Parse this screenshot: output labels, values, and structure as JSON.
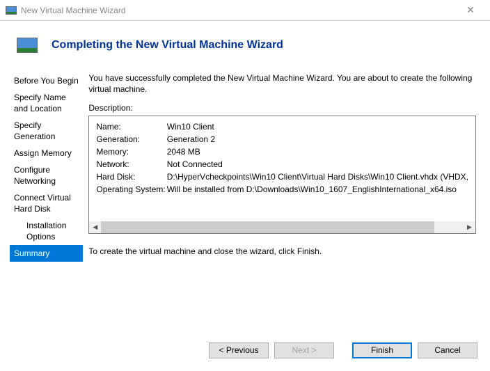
{
  "window": {
    "title": "New Virtual Machine Wizard"
  },
  "header": {
    "title": "Completing the New Virtual Machine Wizard"
  },
  "sidebar": {
    "items": [
      {
        "label": "Before You Begin",
        "indent": false
      },
      {
        "label": "Specify Name and Location",
        "indent": false
      },
      {
        "label": "Specify Generation",
        "indent": false
      },
      {
        "label": "Assign Memory",
        "indent": false
      },
      {
        "label": "Configure Networking",
        "indent": false
      },
      {
        "label": "Connect Virtual Hard Disk",
        "indent": false
      },
      {
        "label": "Installation Options",
        "indent": true
      },
      {
        "label": "Summary",
        "indent": false,
        "selected": true
      }
    ]
  },
  "main": {
    "intro": "You have successfully completed the New Virtual Machine Wizard. You are about to create the following virtual machine.",
    "description_label": "Description:",
    "summary": {
      "name_label": "Name:",
      "name_value": "Win10 Client",
      "generation_label": "Generation:",
      "generation_value": "Generation 2",
      "memory_label": "Memory:",
      "memory_value": "2048 MB",
      "network_label": "Network:",
      "network_value": "Not Connected",
      "harddisk_label": "Hard Disk:",
      "harddisk_value": "D:\\HyperVcheckpoints\\Win10 Client\\Virtual Hard Disks\\Win10 Client.vhdx (VHDX,",
      "os_label": "Operating System:",
      "os_value": "Will be installed from D:\\Downloads\\Win10_1607_EnglishInternational_x64.iso"
    },
    "finish_text": "To create the virtual machine and close the wizard, click Finish."
  },
  "buttons": {
    "previous": "< Previous",
    "next": "Next >",
    "finish": "Finish",
    "cancel": "Cancel"
  }
}
